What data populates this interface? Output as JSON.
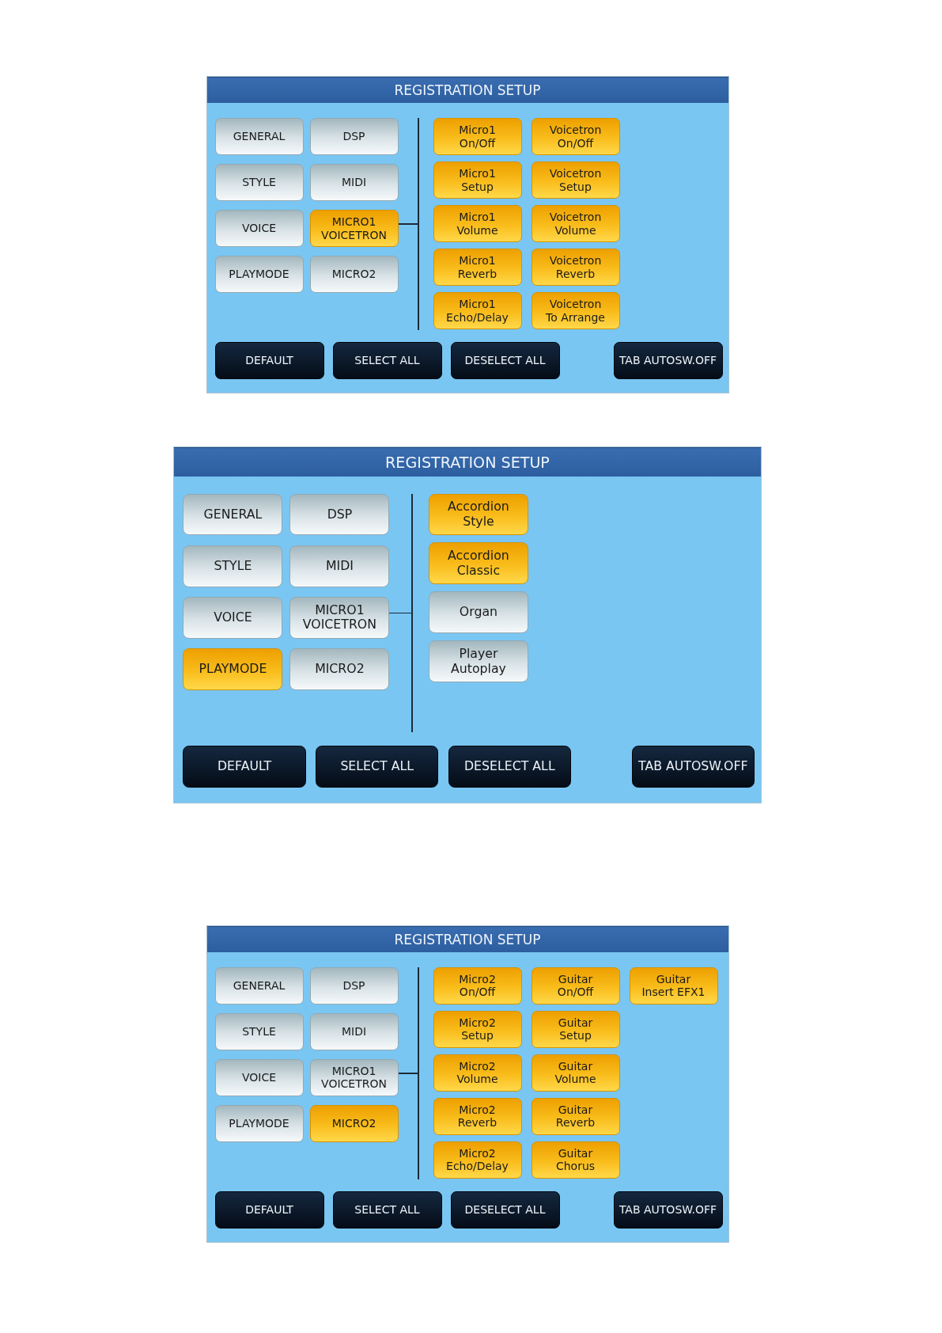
{
  "panels": [
    {
      "title": "REGISTRATION SETUP",
      "categories": [
        {
          "label": "GENERAL",
          "selected": false
        },
        {
          "label": "DSP",
          "selected": false
        },
        {
          "label": "STYLE",
          "selected": false
        },
        {
          "label": "MIDI",
          "selected": false
        },
        {
          "label": "VOICE",
          "selected": false
        },
        {
          "label": "MICRO1\nVOICETRON",
          "selected": true
        },
        {
          "label": "PLAYMODE",
          "selected": false
        },
        {
          "label": "MICRO2",
          "selected": false
        }
      ],
      "option_columns": [
        {
          "options": [
            {
              "label": "Micro1\nOn/Off",
              "on": true
            },
            {
              "label": "Micro1\nSetup",
              "on": true
            },
            {
              "label": "Micro1\nVolume",
              "on": true
            },
            {
              "label": "Micro1\nReverb",
              "on": true
            },
            {
              "label": "Micro1\nEcho/Delay",
              "on": true
            }
          ]
        },
        {
          "options": [
            {
              "label": "Voicetron\nOn/Off",
              "on": true
            },
            {
              "label": "Voicetron\nSetup",
              "on": true
            },
            {
              "label": "Voicetron\nVolume",
              "on": true
            },
            {
              "label": "Voicetron\nReverb",
              "on": true
            },
            {
              "label": "Voicetron\nTo Arrange",
              "on": true
            }
          ]
        }
      ],
      "actions": [
        "DEFAULT",
        "SELECT ALL",
        "DESELECT ALL"
      ],
      "autoswitch_button": "TAB AUTOSW.OFF"
    },
    {
      "title": "REGISTRATION SETUP",
      "categories": [
        {
          "label": "GENERAL",
          "selected": false
        },
        {
          "label": "DSP",
          "selected": false
        },
        {
          "label": "STYLE",
          "selected": false
        },
        {
          "label": "MIDI",
          "selected": false
        },
        {
          "label": "VOICE",
          "selected": false
        },
        {
          "label": "MICRO1\nVOICETRON",
          "selected": false
        },
        {
          "label": "PLAYMODE",
          "selected": true
        },
        {
          "label": "MICRO2",
          "selected": false
        }
      ],
      "option_columns": [
        {
          "options": [
            {
              "label": "Accordion\nStyle",
              "on": true
            },
            {
              "label": "Accordion\nClassic",
              "on": true
            },
            {
              "label": "Organ",
              "on": false
            },
            {
              "label": "Player\nAutoplay",
              "on": false
            }
          ]
        }
      ],
      "actions": [
        "DEFAULT",
        "SELECT ALL",
        "DESELECT ALL"
      ],
      "autoswitch_button": "TAB AUTOSW.OFF"
    },
    {
      "title": "REGISTRATION SETUP",
      "categories": [
        {
          "label": "GENERAL",
          "selected": false
        },
        {
          "label": "DSP",
          "selected": false
        },
        {
          "label": "STYLE",
          "selected": false
        },
        {
          "label": "MIDI",
          "selected": false
        },
        {
          "label": "VOICE",
          "selected": false
        },
        {
          "label": "MICRO1\nVOICETRON",
          "selected": false
        },
        {
          "label": "PLAYMODE",
          "selected": false
        },
        {
          "label": "MICRO2",
          "selected": true
        }
      ],
      "option_columns": [
        {
          "options": [
            {
              "label": "Micro2\nOn/Off",
              "on": true
            },
            {
              "label": "Micro2\nSetup",
              "on": true
            },
            {
              "label": "Micro2\nVolume",
              "on": true
            },
            {
              "label": "Micro2\nReverb",
              "on": true
            },
            {
              "label": "Micro2\nEcho/Delay",
              "on": true
            }
          ]
        },
        {
          "options": [
            {
              "label": "Guitar\nOn/Off",
              "on": true
            },
            {
              "label": "Guitar\nSetup",
              "on": true
            },
            {
              "label": "Guitar\nVolume",
              "on": true
            },
            {
              "label": "Guitar\nReverb",
              "on": true
            },
            {
              "label": "Guitar\nChorus",
              "on": true
            }
          ]
        },
        {
          "options": [
            {
              "label": "Guitar\nInsert EFX1",
              "on": true
            }
          ]
        }
      ],
      "actions": [
        "DEFAULT",
        "SELECT ALL",
        "DESELECT ALL"
      ],
      "autoswitch_button": "TAB AUTOSW.OFF"
    }
  ]
}
